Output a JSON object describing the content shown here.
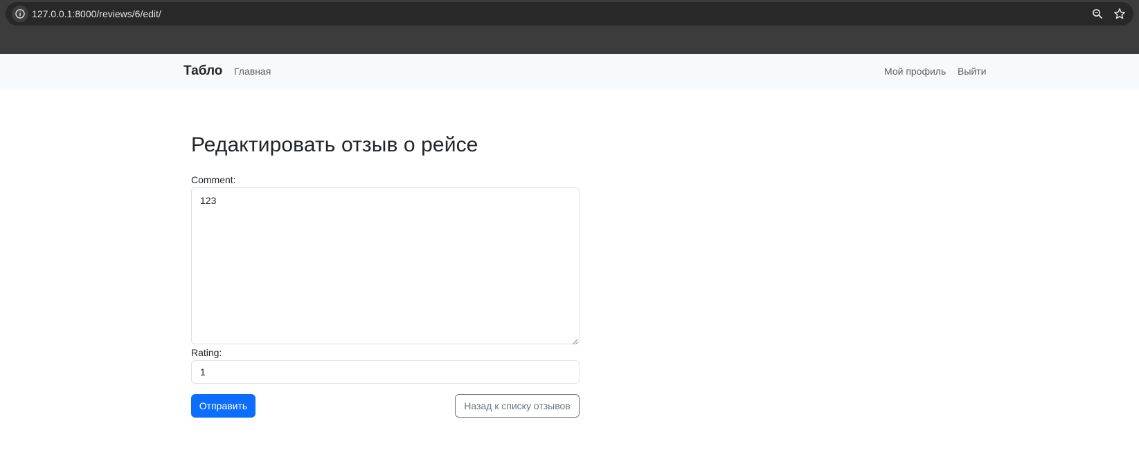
{
  "browser": {
    "url": "127.0.0.1:8000/reviews/6/edit/",
    "icons": {
      "site_info": "info-icon",
      "zoom": "zoom-icon",
      "bookmark": "star-icon"
    }
  },
  "navbar": {
    "brand": "Табло",
    "home_link": "Главная",
    "profile_link": "Мой профиль",
    "logout_link": "Выйти"
  },
  "form": {
    "title": "Редактировать отзыв о рейсе",
    "comment_label": "Comment:",
    "comment_value": "123",
    "rating_label": "Rating:",
    "rating_value": "1",
    "submit_label": "Отправить",
    "back_label": "Назад к списку отзывов"
  },
  "colors": {
    "primary": "#0d6efd",
    "secondary": "#6c757d",
    "navbar_bg": "#f8f9fa",
    "chrome_bg": "#3c3c3c"
  }
}
